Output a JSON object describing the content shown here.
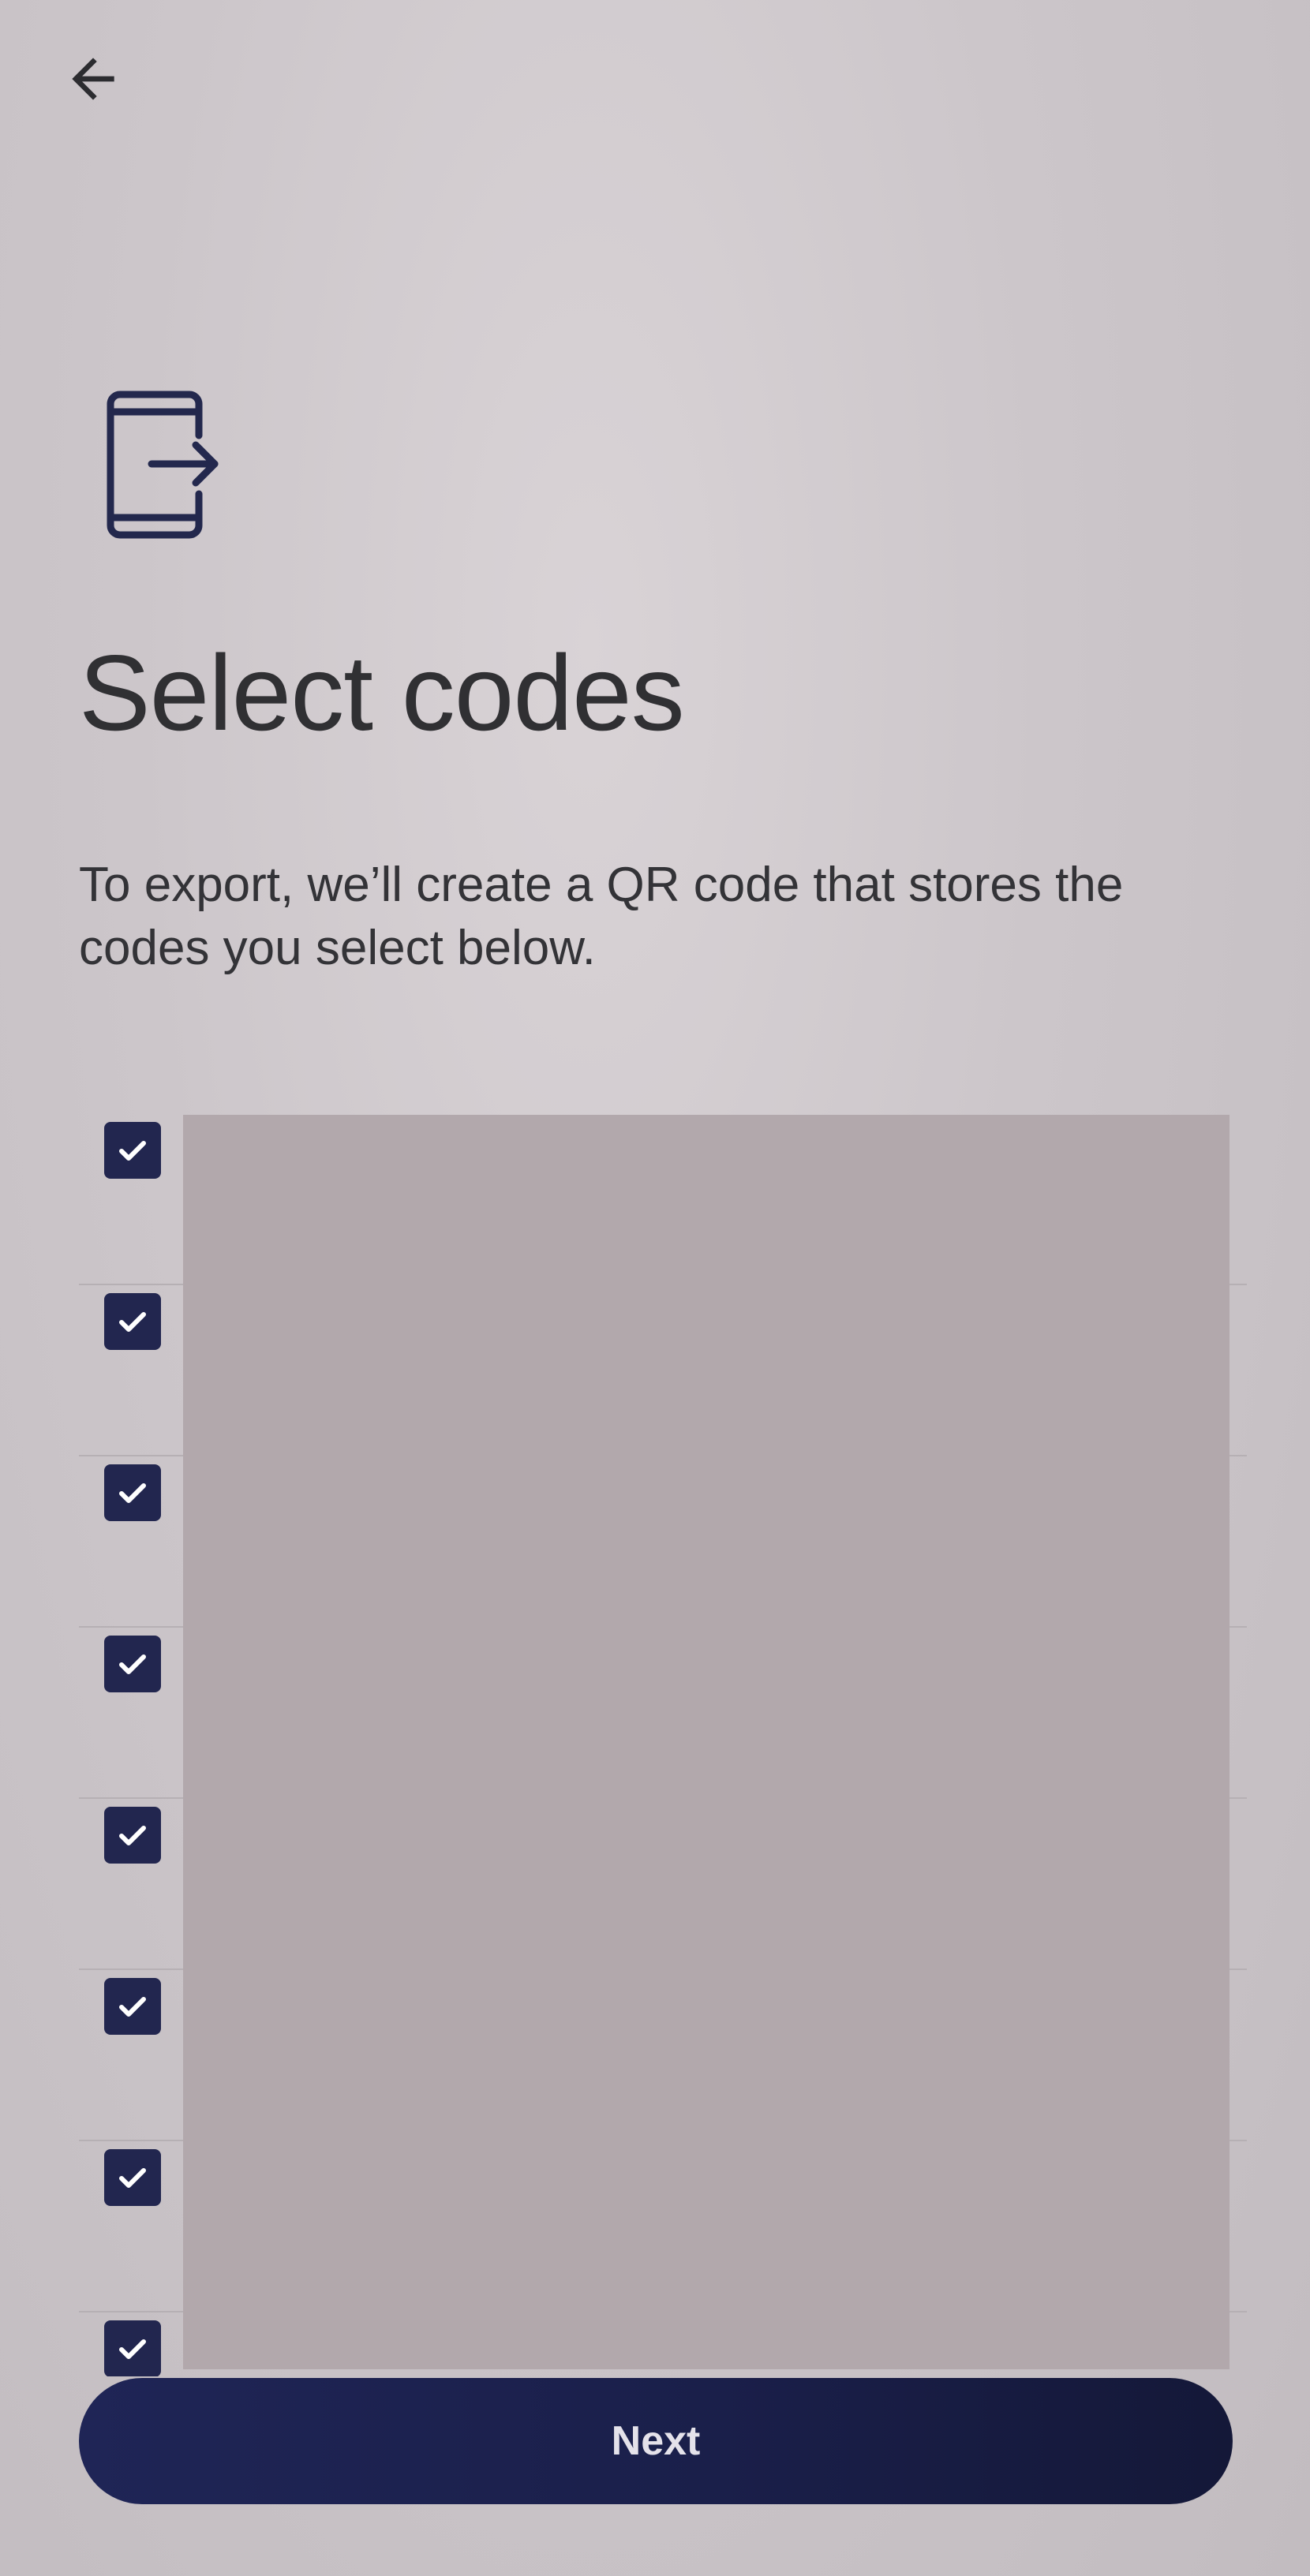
{
  "header": {
    "back_icon": "arrow-left-icon",
    "feature_icon": "export-phone-icon"
  },
  "title": "Select codes",
  "description": "To export, we’ll create a QR code that stores the codes you select below.",
  "codes": [
    {
      "checked": true
    },
    {
      "checked": true
    },
    {
      "checked": true
    },
    {
      "checked": true
    },
    {
      "checked": true
    },
    {
      "checked": true
    },
    {
      "checked": true
    },
    {
      "checked": true
    }
  ],
  "next_button": {
    "label": "Next"
  },
  "colors": {
    "accent": "#22264f",
    "background": "#ccc6ca",
    "redaction": "#b2a8ac"
  }
}
